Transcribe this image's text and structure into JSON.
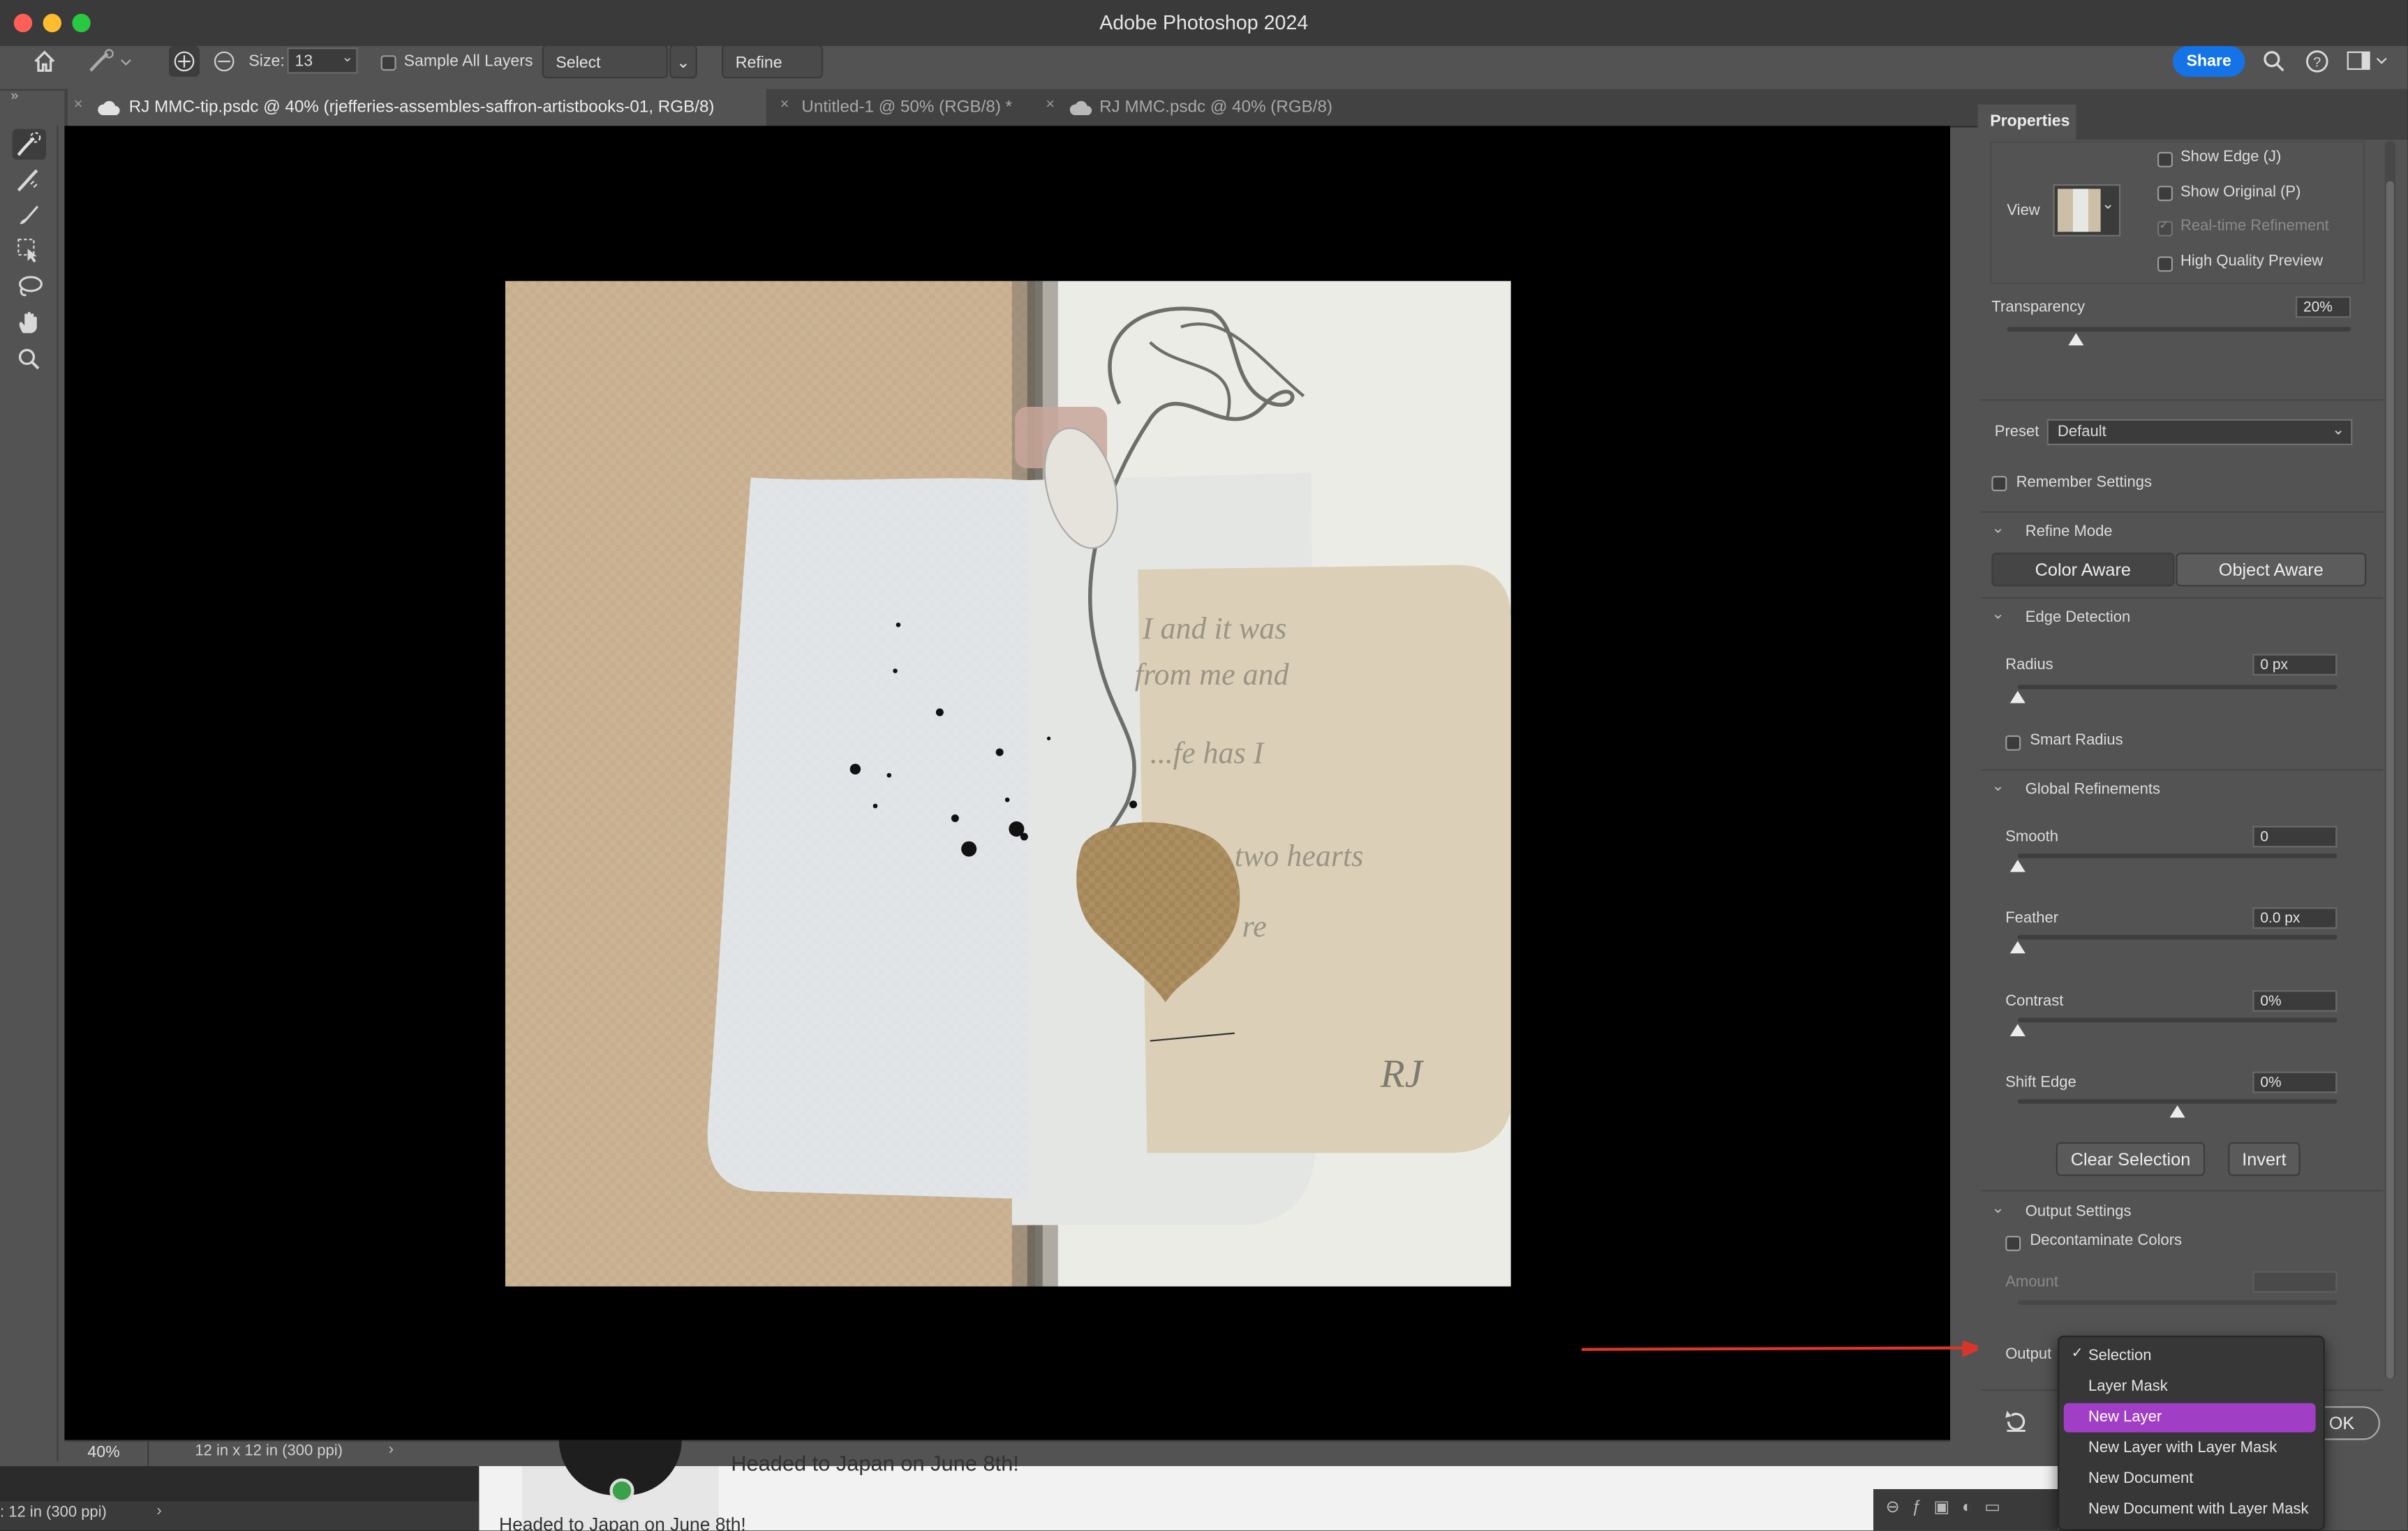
{
  "window": {
    "title": "Adobe Photoshop 2024"
  },
  "options": {
    "size_label": "Size:",
    "size_value": "13",
    "sample_all_layers": "Sample All Layers",
    "select_subject": "Select Subject",
    "refine_hair": "Refine Hair",
    "share": "Share"
  },
  "tabs": [
    {
      "label": "RJ MMC-tip.psdc @ 40% (rjefferies-assembles-saffron-artistbooks-01, RGB/8)"
    },
    {
      "label": "Untitled-1 @ 50% (RGB/8) *"
    },
    {
      "label": "RJ MMC.psdc @ 40% (RGB/8)"
    }
  ],
  "status": {
    "zoom": "40%",
    "doc_size": "12 in x 12 in (300 ppi)",
    "bottom_doc_size": ": 12 in (300 ppi)"
  },
  "behind": {
    "caption_1": "Headed to Japan on June 8th!",
    "caption_2": "Headed to Japan on June 8th!"
  },
  "properties": {
    "tab": "Properties",
    "view_label": "View",
    "show_edge": "Show Edge (J)",
    "show_original": "Show Original (P)",
    "realtime_refinement": "Real-time Refinement",
    "high_quality_preview": "High Quality Preview",
    "transparency_label": "Transparency",
    "transparency_value": "20%",
    "transparency_level": 0.2,
    "preset_label": "Preset",
    "preset_value": "Default",
    "remember_settings": "Remember Settings",
    "refine_mode": {
      "header": "Refine Mode",
      "color_aware": "Color Aware",
      "object_aware": "Object Aware"
    },
    "edge_detection": {
      "header": "Edge Detection",
      "radius_label": "Radius",
      "radius_value": "0 px",
      "smart_radius": "Smart Radius"
    },
    "global_refinements": {
      "header": "Global Refinements",
      "smooth_label": "Smooth",
      "smooth_value": "0",
      "feather_label": "Feather",
      "feather_value": "0.0 px",
      "contrast_label": "Contrast",
      "contrast_value": "0%",
      "shift_edge_label": "Shift Edge",
      "shift_edge_value": "0%",
      "clear_selection": "Clear Selection",
      "invert": "Invert"
    },
    "output_settings": {
      "header": "Output Settings",
      "decontaminate": "Decontaminate Colors",
      "amount_label": "Amount",
      "output_label": "Output",
      "ok": "OK"
    }
  },
  "output_menu": {
    "check": "✓",
    "items": [
      {
        "label": "Selection"
      },
      {
        "label": "Layer Mask"
      },
      {
        "label": "New Layer"
      },
      {
        "label": "New Layer with Layer Mask"
      },
      {
        "label": "New Document"
      },
      {
        "label": "New Document with Layer Mask"
      }
    ]
  },
  "artwork": {
    "handwriting": [
      "I and it was",
      "from me and",
      "...fe has I",
      "two hearts",
      "re"
    ],
    "initials": "RJ"
  },
  "colors": {
    "accent_blue": "#1473e6",
    "menu_highlight": "#a03fc6",
    "annotation_arrow": "#d8362b"
  }
}
